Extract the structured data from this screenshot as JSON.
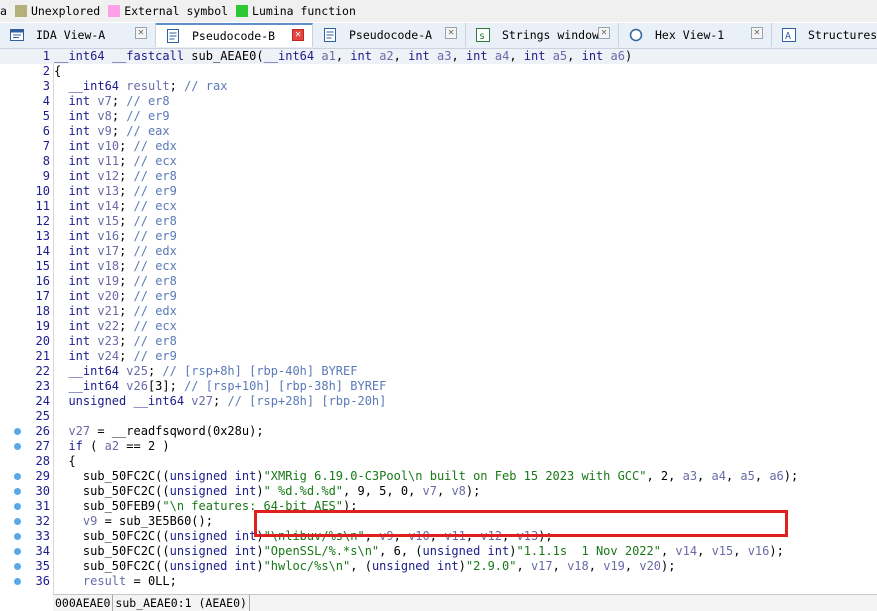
{
  "legend": [
    {
      "label": "a",
      "color": ""
    },
    {
      "label": "Unexplored",
      "color": "#b4b07a"
    },
    {
      "label": "External symbol",
      "color": "#ff9ee9"
    },
    {
      "label": "Lumina function",
      "color": "#2ec834"
    }
  ],
  "tabs": [
    {
      "label": "IDA View-A",
      "icon": "ida-view-icon"
    },
    {
      "label": "Pseudocode-B",
      "icon": "pseudocode-icon",
      "active": true
    },
    {
      "label": "Pseudocode-A",
      "icon": "pseudocode-icon"
    },
    {
      "label": "Strings window",
      "icon": "strings-icon"
    },
    {
      "label": "Hex View-1",
      "icon": "hex-view-icon"
    },
    {
      "label": "Structures",
      "icon": "structures-icon"
    }
  ],
  "code_lines": [
    {
      "n": "1",
      "t": "__int64 __fastcall sub_AEAE0(__int64 a1, int a2, int a3, int a4, int a5, int a6)"
    },
    {
      "n": "2",
      "t": "{"
    },
    {
      "n": "3",
      "t": "  __int64 result; // rax"
    },
    {
      "n": "4",
      "t": "  int v7; // er8"
    },
    {
      "n": "5",
      "t": "  int v8; // er9"
    },
    {
      "n": "6",
      "t": "  int v9; // eax"
    },
    {
      "n": "7",
      "t": "  int v10; // edx"
    },
    {
      "n": "8",
      "t": "  int v11; // ecx"
    },
    {
      "n": "9",
      "t": "  int v12; // er8"
    },
    {
      "n": "10",
      "t": "  int v13; // er9"
    },
    {
      "n": "11",
      "t": "  int v14; // ecx"
    },
    {
      "n": "12",
      "t": "  int v15; // er8"
    },
    {
      "n": "13",
      "t": "  int v16; // er9"
    },
    {
      "n": "14",
      "t": "  int v17; // edx"
    },
    {
      "n": "15",
      "t": "  int v18; // ecx"
    },
    {
      "n": "16",
      "t": "  int v19; // er8"
    },
    {
      "n": "17",
      "t": "  int v20; // er9"
    },
    {
      "n": "18",
      "t": "  int v21; // edx"
    },
    {
      "n": "19",
      "t": "  int v22; // ecx"
    },
    {
      "n": "20",
      "t": "  int v23; // er8"
    },
    {
      "n": "21",
      "t": "  int v24; // er9"
    },
    {
      "n": "22",
      "t": "  __int64 v25; // [rsp+8h] [rbp-40h] BYREF"
    },
    {
      "n": "23",
      "t": "  __int64 v26[3]; // [rsp+10h] [rbp-38h] BYREF"
    },
    {
      "n": "24",
      "t": "  unsigned __int64 v27; // [rsp+28h] [rbp-20h]"
    },
    {
      "n": "25",
      "t": ""
    },
    {
      "n": "26",
      "t": "  v27 = __readfsqword(0x28u);",
      "dot": true
    },
    {
      "n": "27",
      "t": "  if ( a2 == 2 )",
      "dot": true
    },
    {
      "n": "28",
      "t": "  {"
    },
    {
      "n": "29",
      "t": "    sub_50FC2C((unsigned int)\"XMRig 6.19.0-C3Pool\\n built on Feb 15 2023 with GCC\", 2, a3, a4, a5, a6);",
      "dot": true
    },
    {
      "n": "30",
      "t": "    sub_50FC2C((unsigned int)\" %d.%d.%d\", 9, 5, 0, v7, v8);",
      "dot": true
    },
    {
      "n": "31",
      "t": "    sub_50FEB9(\"\\n features: 64-bit AES\");",
      "dot": true
    },
    {
      "n": "32",
      "t": "    v9 = sub_3E5B60();",
      "dot": true
    },
    {
      "n": "33",
      "t": "    sub_50FC2C((unsigned int)\"\\nlibuv/%s\\n\", v9, v10, v11, v12, v13);",
      "dot": true
    },
    {
      "n": "34",
      "t": "    sub_50FC2C((unsigned int)\"OpenSSL/%.*s\\n\", 6, (unsigned int)\"1.1.1s  1 Nov 2022\", v14, v15, v16);",
      "dot": true
    },
    {
      "n": "35",
      "t": "    sub_50FC2C((unsigned int)\"hwloc/%s\\n\", (unsigned int)\"2.9.0\", v17, v18, v19, v20);",
      "dot": true
    },
    {
      "n": "36",
      "t": "    result = 0LL;",
      "dot": true
    }
  ],
  "status": {
    "address": "000AEAE0",
    "location": "sub_AEAE0:1 (AEAE0)"
  },
  "colors": {
    "keyword": "#1c1c8c",
    "comment": "#5a7ab7",
    "string": "#187818",
    "highlight_box": "#e01f1f",
    "breakpoint_dot": "#5aa9e6"
  }
}
